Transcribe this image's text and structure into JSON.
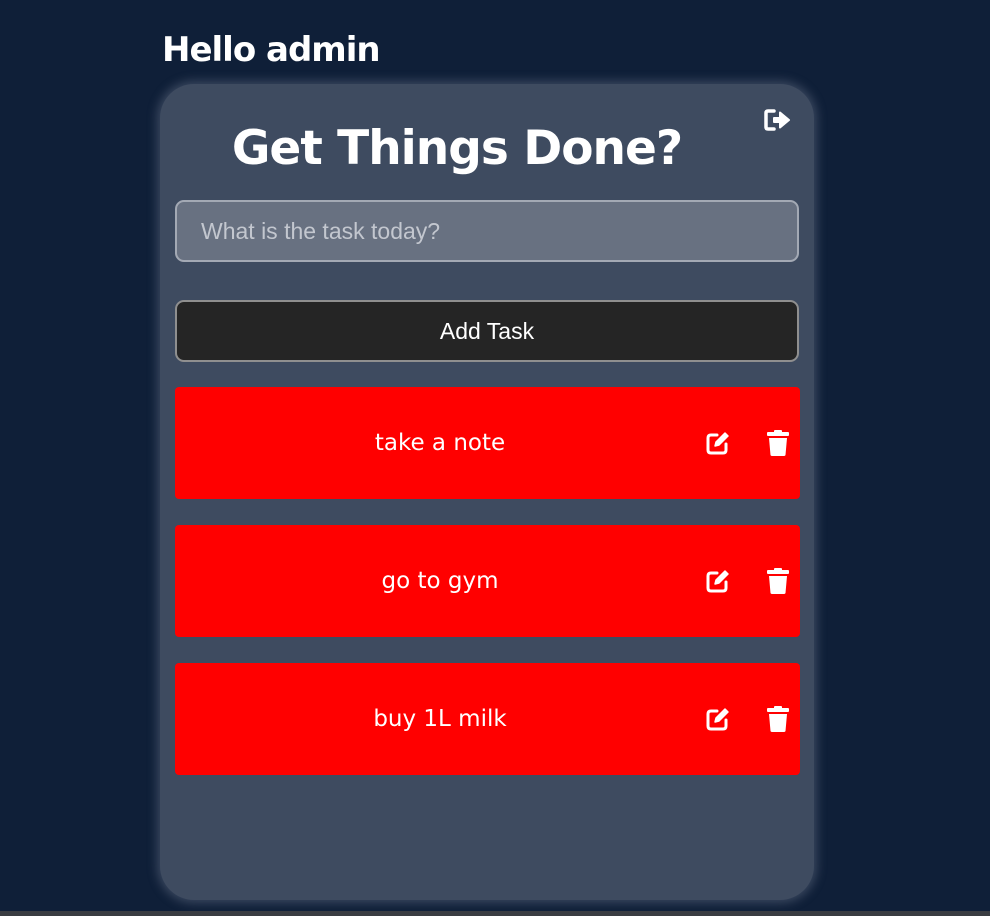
{
  "greeting": "Hello admin",
  "title": "Get Things Done?",
  "task_input": {
    "placeholder": "What is the task today?",
    "value": ""
  },
  "add_button_label": "Add Task",
  "icons": {
    "logout": "sign-out-icon",
    "edit": "edit-icon",
    "delete": "trash-icon"
  },
  "colors": {
    "background": "#0f1f38",
    "card": "#3e4b60",
    "task": "#ff0000",
    "button": "#252525"
  },
  "tasks": [
    {
      "text": "take a note"
    },
    {
      "text": "go to gym"
    },
    {
      "text": "buy 1L milk"
    }
  ]
}
